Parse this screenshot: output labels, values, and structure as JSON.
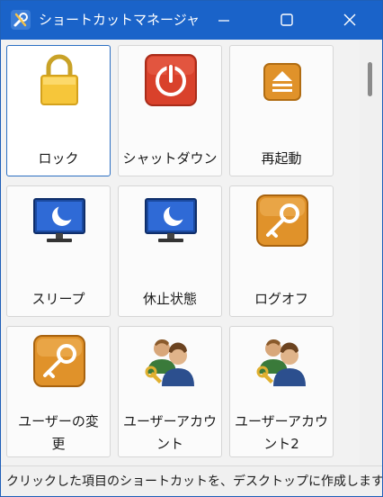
{
  "window": {
    "title": "ショートカットマネージャ...",
    "buttons": {
      "minimize": "minimize-icon",
      "maximize": "maximize-icon",
      "close": "close-icon"
    }
  },
  "tiles": [
    {
      "label": "ロック",
      "icon": "lock-icon",
      "selected": true
    },
    {
      "label": "シャットダウン",
      "icon": "power-icon"
    },
    {
      "label": "再起動",
      "icon": "restart-icon"
    },
    {
      "label": "スリープ",
      "icon": "monitor-moon-icon"
    },
    {
      "label": "休止状態",
      "icon": "monitor-moon-icon"
    },
    {
      "label": "ログオフ",
      "icon": "key-icon"
    },
    {
      "label_line1": "ユーザーの変",
      "label_line2": "更",
      "icon": "key-icon"
    },
    {
      "label_line1": "ユーザーアカウ",
      "label_line2": "ント",
      "icon": "users-icon"
    },
    {
      "label_line1": "ユーザーアカウ",
      "label_line2": "ント2",
      "icon": "users-icon"
    }
  ],
  "status": {
    "text": "クリックした項目のショートカットを、デスクトップに作成します"
  },
  "colors": {
    "titlebar": "#1a63c9",
    "selected_border": "#2c6fc2",
    "accent_orange": "#e0922a",
    "power_red": "#d9412b"
  }
}
